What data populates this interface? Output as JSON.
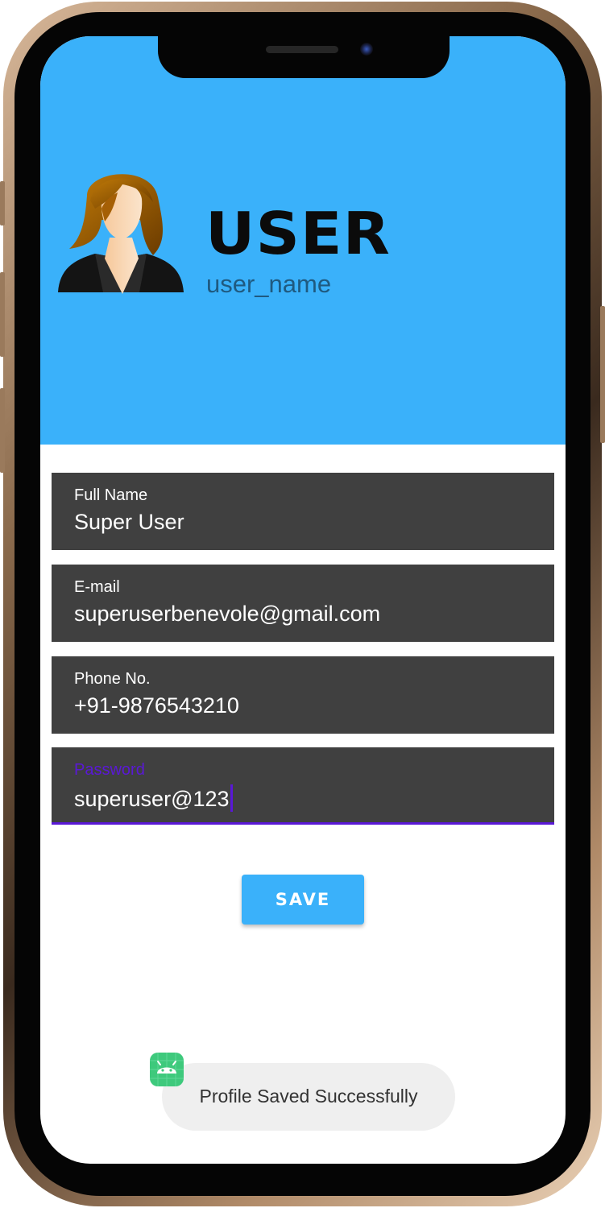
{
  "header": {
    "title": "USER",
    "subtitle": "user_name",
    "background_color": "#3ab1fa"
  },
  "form": {
    "fields": [
      {
        "label": "Full Name",
        "value": "Super User"
      },
      {
        "label": "E-mail",
        "value": "superuserbenevole@gmail.com"
      },
      {
        "label": "Phone No.",
        "value": "+91-9876543210"
      },
      {
        "label": "Password",
        "value": "superuser@123",
        "focused": true
      }
    ],
    "field_background": "#404040",
    "focus_color": "#5a18d6"
  },
  "save_button": {
    "label": "SAVE"
  },
  "toast": {
    "message": "Profile Saved Successfully",
    "icon": "android-icon"
  }
}
